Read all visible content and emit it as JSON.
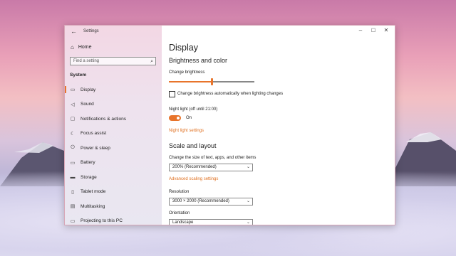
{
  "window": {
    "title": "Settings",
    "back_icon": "back-arrow-icon",
    "controls": [
      "minimize-icon",
      "maximize-icon",
      "close-icon"
    ]
  },
  "sidebar": {
    "home_label": "Home",
    "search_placeholder": "Find a setting",
    "section_label": "System",
    "items": [
      {
        "label": "Display",
        "icon": "display-icon",
        "active": true
      },
      {
        "label": "Sound",
        "icon": "sound-icon"
      },
      {
        "label": "Notifications & actions",
        "icon": "notifications-icon"
      },
      {
        "label": "Focus assist",
        "icon": "focus-assist-icon"
      },
      {
        "label": "Power & sleep",
        "icon": "power-icon"
      },
      {
        "label": "Battery",
        "icon": "battery-icon"
      },
      {
        "label": "Storage",
        "icon": "storage-icon"
      },
      {
        "label": "Tablet mode",
        "icon": "tablet-icon"
      },
      {
        "label": "Multitasking",
        "icon": "multitasking-icon"
      },
      {
        "label": "Projecting to this PC",
        "icon": "projecting-icon"
      }
    ]
  },
  "main": {
    "page_title": "Display",
    "brightness": {
      "heading": "Brightness and color",
      "change_label": "Change brightness",
      "level": 0.5,
      "auto_checkbox_label": "Change brightness automatically when lighting changes",
      "auto_checked": false
    },
    "night_light": {
      "label": "Night light (off until 21:00)",
      "state_text": "On",
      "settings_link": "Night light settings"
    },
    "scale": {
      "heading": "Scale and layout",
      "size_label": "Change the size of text, apps, and other items",
      "size_value": "200% (Recommended)",
      "advanced_link": "Advanced scaling settings",
      "resolution_label": "Resolution",
      "resolution_value": "3000 × 2000 (Recommended)",
      "orientation_label": "Orientation",
      "orientation_value": "Landscape"
    }
  },
  "colors": {
    "accent": "#e8742b"
  }
}
